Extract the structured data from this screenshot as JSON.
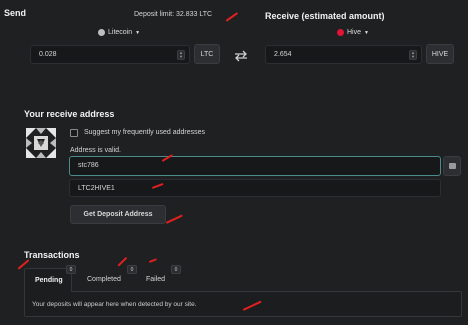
{
  "send": {
    "title": "Send",
    "deposit_limit": "Deposit limit: 32.833 LTC",
    "coin": "Litecoin",
    "amount": "0.028",
    "unit": "LTC"
  },
  "receive": {
    "title": "Receive (estimated amount)",
    "coin": "Hive",
    "amount": "2.654",
    "unit": "HIVE"
  },
  "address_section": {
    "title": "Your receive address",
    "suggest_label": "Suggest my frequently used addresses",
    "valid_text": "Address is valid.",
    "address_value": "stc786",
    "memo_value": "LTC2HIVE1",
    "deposit_button": "Get Deposit Address"
  },
  "transactions": {
    "title": "Transactions",
    "tabs": [
      {
        "label": "Pending",
        "count": "0"
      },
      {
        "label": "Completed",
        "count": "0"
      },
      {
        "label": "Failed",
        "count": "0"
      }
    ],
    "empty_message": "Your deposits will appear here when detected by our site."
  },
  "colors": {
    "background": "#1f2022",
    "litecoin": "#bfbfbf",
    "hive": "#e31337",
    "annotation": "#e02020"
  },
  "icons": {
    "swap": "swap-arrows-icon",
    "chevron": "chevron-down-icon",
    "address_book": "address-book-icon",
    "identicon": "identicon-avatar"
  }
}
